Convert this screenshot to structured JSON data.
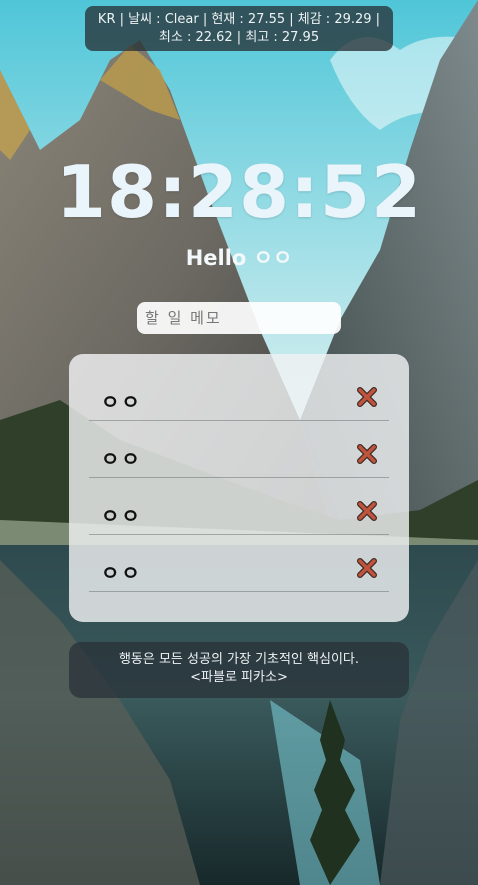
{
  "weather": {
    "line1": "KR | 날씨 : Clear | 현재 : 27.55 | 체감 : 29.29 |",
    "line2": "최소 : 22.62 | 최고 : 27.95"
  },
  "clock": {
    "time": "18:28:52"
  },
  "greeting": {
    "text": "Hello ㅇㅇ"
  },
  "memo": {
    "placeholder": "할 일 메모",
    "value": ""
  },
  "todos": [
    {
      "text": "ㅇㅇ",
      "delete_icon": "close-x-icon"
    },
    {
      "text": "ㅇㅇ",
      "delete_icon": "close-x-icon"
    },
    {
      "text": "ㅇㅇ",
      "delete_icon": "close-x-icon"
    },
    {
      "text": "ㅇㅇ",
      "delete_icon": "close-x-icon"
    }
  ],
  "quote": {
    "text": "행동은 모든 성공의 가장 기초적인 핵심이다.",
    "author": "<파블로 피카소>"
  },
  "colors": {
    "delete_icon": "#c0533d",
    "clock": "#eaf4fb"
  }
}
